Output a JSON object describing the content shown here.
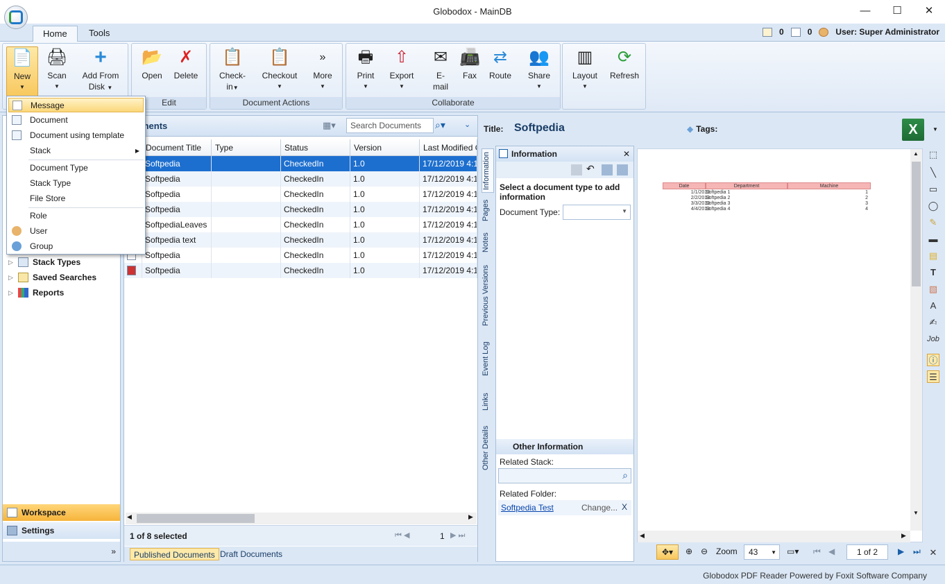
{
  "window": {
    "title": "Globodox - MainDB",
    "min": "—",
    "max": "☐",
    "close": "✕"
  },
  "tabs": [
    {
      "label": "Home"
    },
    {
      "label": "Tools"
    }
  ],
  "status_right": {
    "tasks_count": "0",
    "mail_count": "0",
    "user": "User: Super Administrator"
  },
  "ribbon": {
    "new": "New",
    "scan": "Scan",
    "add_from_disk_1": "Add From",
    "add_from_disk_2": "Disk",
    "open": "Open",
    "delete": "Delete",
    "edit_group": "Edit",
    "checkin_1": "Check-",
    "checkin_2": "in",
    "checkout": "Checkout",
    "more": "More",
    "doc_actions_group": "Document Actions",
    "print": "Print",
    "export": "Export",
    "email_1": "E-",
    "email_2": "mail",
    "fax": "Fax",
    "route": "Route",
    "share": "Share",
    "collaborate_group": "Collaborate",
    "layout": "Layout",
    "refresh": "Refresh"
  },
  "new_menu": [
    {
      "label": "Message"
    },
    {
      "label": "Document"
    },
    {
      "label": "Document using template"
    },
    {
      "label": "Stack"
    },
    {
      "label": "Document Type"
    },
    {
      "label": "Stack Type"
    },
    {
      "label": "File Store"
    },
    {
      "label": "Role"
    },
    {
      "label": "User"
    },
    {
      "label": "Group"
    }
  ],
  "tree": [
    {
      "label": "Stack Types"
    },
    {
      "label": "Saved Searches"
    },
    {
      "label": "Reports"
    }
  ],
  "nav": {
    "workspace": "Workspace",
    "settings": "Settings",
    "more": "»"
  },
  "docs": {
    "title": "ments",
    "search_placeholder": "Search Documents",
    "columns": [
      "Document Title",
      "Type",
      "Status",
      "Version",
      "Last Modified O"
    ],
    "rows": [
      {
        "title": "Softpedia",
        "type": "",
        "status": "CheckedIn",
        "version": "1.0",
        "modified": "17/12/2019  4:1"
      },
      {
        "title": "Softpedia",
        "type": "",
        "status": "CheckedIn",
        "version": "1.0",
        "modified": "17/12/2019  4:1"
      },
      {
        "title": "Softpedia",
        "type": "",
        "status": "CheckedIn",
        "version": "1.0",
        "modified": "17/12/2019  4:1"
      },
      {
        "title": "Softpedia",
        "type": "",
        "status": "CheckedIn",
        "version": "1.0",
        "modified": "17/12/2019  4:1"
      },
      {
        "title": "SoftpediaLeaves",
        "type": "",
        "status": "CheckedIn",
        "version": "1.0",
        "modified": "17/12/2019  4:1"
      },
      {
        "title": "Softpedia text",
        "type": "",
        "status": "CheckedIn",
        "version": "1.0",
        "modified": "17/12/2019  4:1"
      },
      {
        "title": "Softpedia",
        "type": "",
        "status": "CheckedIn",
        "version": "1.0",
        "modified": "17/12/2019  4:1"
      },
      {
        "title": "Softpedia",
        "type": "",
        "status": "CheckedIn",
        "version": "1.0",
        "modified": "17/12/2019  4:1"
      }
    ],
    "selection": "1 of 8 selected",
    "page": "1",
    "bottom_tabs": [
      {
        "label": "Published Documents"
      },
      {
        "label": "Draft Documents"
      }
    ]
  },
  "details": {
    "title_label": "Title:",
    "title_value": "Softpedia",
    "tags_label": "Tags:",
    "vtabs": [
      "Information",
      "Pages",
      "Notes",
      "Previous Versions",
      "Event Log",
      "Links",
      "Other Details"
    ],
    "info_header": "Information",
    "prompt": "Select a document type to add information",
    "doctype_label": "Document Type:",
    "other_header": "Other Information",
    "related_stack_label": "Related Stack:",
    "related_folder_label": "Related Folder:",
    "folder_link": "Softpedia Test",
    "folder_change": "Change...",
    "folder_remove": "X"
  },
  "pdf": {
    "headers": [
      "Date",
      "Department",
      "Machine"
    ],
    "rows": [
      {
        "date": "1/1/2013",
        "dept": "Softpedia 1",
        "machine": "1"
      },
      {
        "date": "2/2/2013",
        "dept": "Softpedia 2",
        "machine": "2"
      },
      {
        "date": "3/3/2013",
        "dept": "Softpedia 3",
        "machine": "3"
      },
      {
        "date": "4/4/2013",
        "dept": "Softpedia 4",
        "machine": "4"
      }
    ]
  },
  "viewer_bar": {
    "zoom_label": "Zoom",
    "zoom_value": "43",
    "page": "1 of 2"
  },
  "status": {
    "text": "Globodox PDF Reader Powered by Foxit Software Company"
  }
}
